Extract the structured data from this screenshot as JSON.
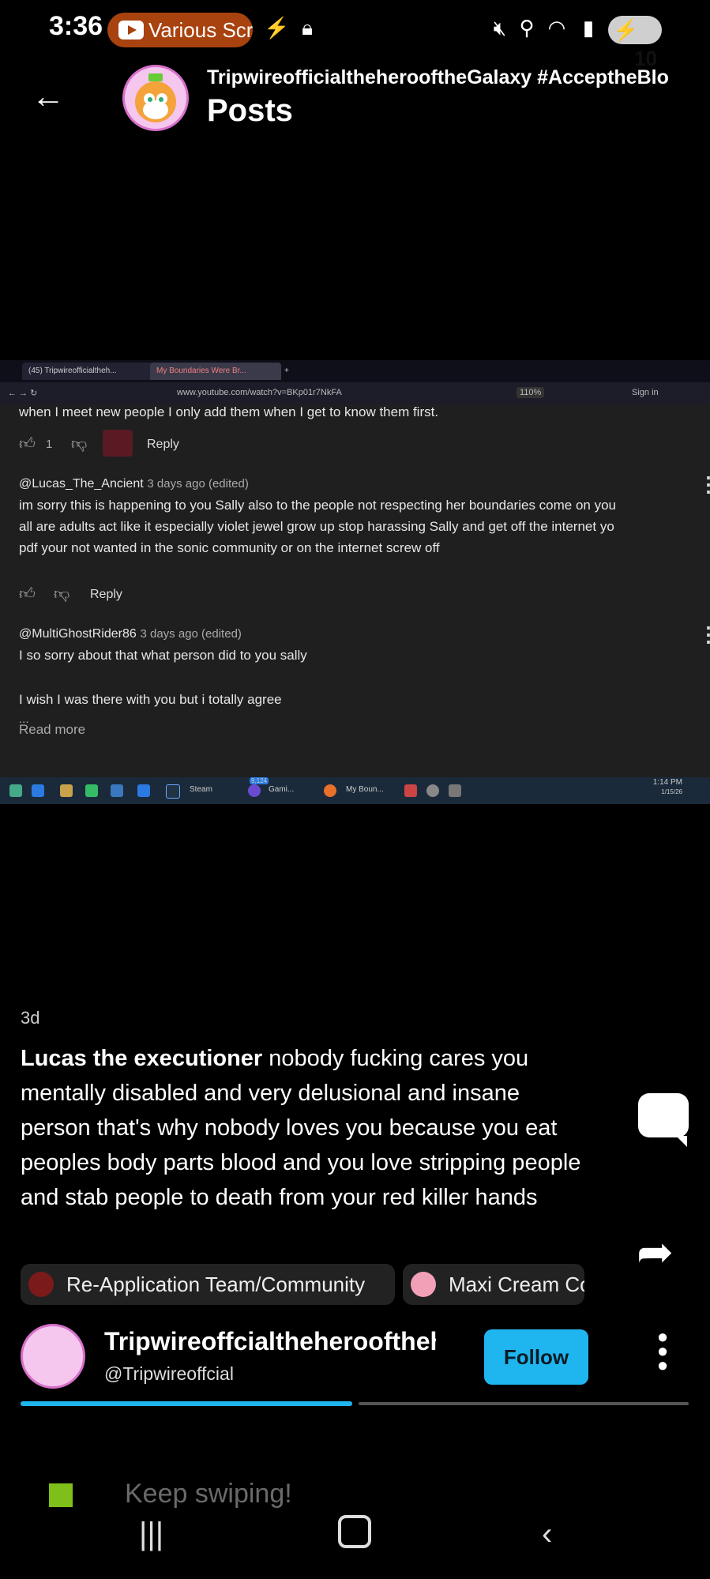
{
  "status_bar": {
    "time": "3:36",
    "media_pill_text": "Various Scre",
    "battery": "10"
  },
  "header": {
    "title": "TripwireofficialtheherooftheGalaxy #AcceptheBlo",
    "subtitle": "Posts"
  },
  "embedded_screenshot": {
    "tabs": [
      "(45) Tripwireofficialtheh...",
      "My Boundaries Were Br..."
    ],
    "url": "www.youtube.com/watch?v=BKp01r7NkFA",
    "zoom": "110%",
    "sign_in": "Sign in",
    "comments": [
      {
        "text_lines": [
          "when I meet new people I only add them when I get to know them first."
        ],
        "likes": "1",
        "reply": "Reply"
      },
      {
        "author": "@Lucas_The_Ancient",
        "meta": "3 days ago (edited)",
        "text_lines": [
          "im sorry this is happening to you Sally also to the people not respecting her boundaries come on you",
          "all are adults act like it especially violet jewel grow up stop harassing Sally and get off the internet yo",
          "pdf your not wanted in the sonic community or on the internet screw off"
        ],
        "reply": "Reply"
      },
      {
        "author": "@MultiGhostRider86",
        "meta": "3 days ago (edited)",
        "text_lines": [
          "I so sorry about that what person did to you sally",
          "",
          "I wish I was there with you but i totally agree",
          "..."
        ],
        "read_more": "Read more"
      }
    ],
    "taskbar": {
      "steam": "Steam",
      "gaming": "Gami...",
      "browser": "My Boun...",
      "clock_time": "1:14 PM",
      "clock_date": "1/15/26",
      "badge": "9,124"
    }
  },
  "post": {
    "age": "3d",
    "mention": "Lucas the executioner",
    "body": " nobody fucking cares you mentally disabled and very delusional and insane person that's why nobody loves you because you eat peoples body parts blood and you love stripping people and stab people to death from your red killer hands",
    "chips": [
      "Re-Application Team/Community",
      "Maxi Cream Co"
    ]
  },
  "author": {
    "name": "Tripwireoffcialtheherooftheh",
    "handle": "@Tripwireoffcial",
    "follow_label": "Follow"
  },
  "footer": {
    "hint": "Keep swiping!"
  },
  "colors": {
    "accent": "#1fb6f0",
    "pill": "#a8420e",
    "background": "#000000"
  }
}
